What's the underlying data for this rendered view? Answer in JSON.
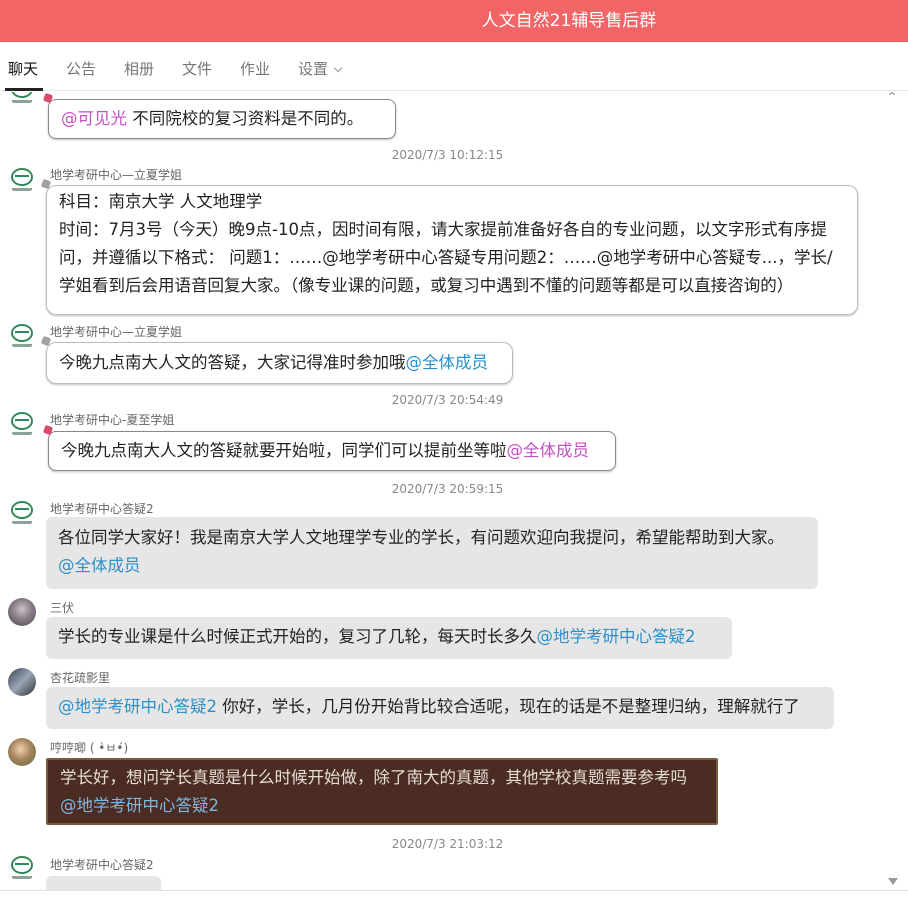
{
  "window": {
    "title": "人文自然21辅导售后群"
  },
  "tabs": [
    {
      "label": "聊天"
    },
    {
      "label": "公告"
    },
    {
      "label": "相册"
    },
    {
      "label": "文件"
    },
    {
      "label": "作业"
    },
    {
      "label": "设置"
    }
  ],
  "messages": [
    {
      "at": "@可见光",
      "text": " 不同院校的复习资料是不同的。"
    },
    {
      "time": "2020/7/3 10:12:15"
    },
    {
      "sender": "地学考研中心—立夏学姐",
      "lines": [
        "科目：南京大学 人文地理学",
        "时间：7月3号（今天）晚9点-10点，因时间有限，请大家提前准备好各自的专业问题，以文字形式有序提",
        "问，并遵循以下格式： 问题1：……@地学考研中心答疑专用问题2：……@地学考研中心答疑专...，学长/",
        "学姐看到后会用语音回复大家。（像专业课的问题，或复习中遇到不懂的问题等都是可以直接咨询的）"
      ]
    },
    {
      "sender": "地学考研中心—立夏学姐",
      "text": "今晚九点南大人文的答疑，大家记得准时参加哦",
      "at": "@全体成员"
    },
    {
      "time": "2020/7/3 20:54:49"
    },
    {
      "sender": "地学考研中心-夏至学姐",
      "text": "今晚九点南大人文的答疑就要开始啦，同学们可以提前坐等啦",
      "at": "@全体成员"
    },
    {
      "time": "2020/7/3 20:59:15"
    },
    {
      "sender": "地学考研中心答疑2",
      "text": "各位同学大家好！我是南京大学人文地理学专业的学长，有问题欢迎向我提问，希望能帮助到大家。",
      "at": "@全体成员"
    },
    {
      "sender": "三伏",
      "text": "学长的专业课是什么时候正式开始的，复习了几轮，每天时长多久",
      "at": "@地学考研中心答疑2"
    },
    {
      "sender": "杏花疏影里",
      "at": "@地学考研中心答疑2",
      "text": " 你好，学长，几月份开始背比较合适呢，现在的话是不是整理归纳，理解就行了"
    },
    {
      "sender": "哼哼唧 ( •̀ㅂ•́)",
      "text": "学长好，想问学长真题是什么时候开始做，除了南大的真题，其他学校真题需要参考吗",
      "at": "@地学考研中心答疑2"
    },
    {
      "time": "2020/7/3 21:03:12"
    },
    {
      "sender": "地学考研中心答疑2"
    }
  ]
}
